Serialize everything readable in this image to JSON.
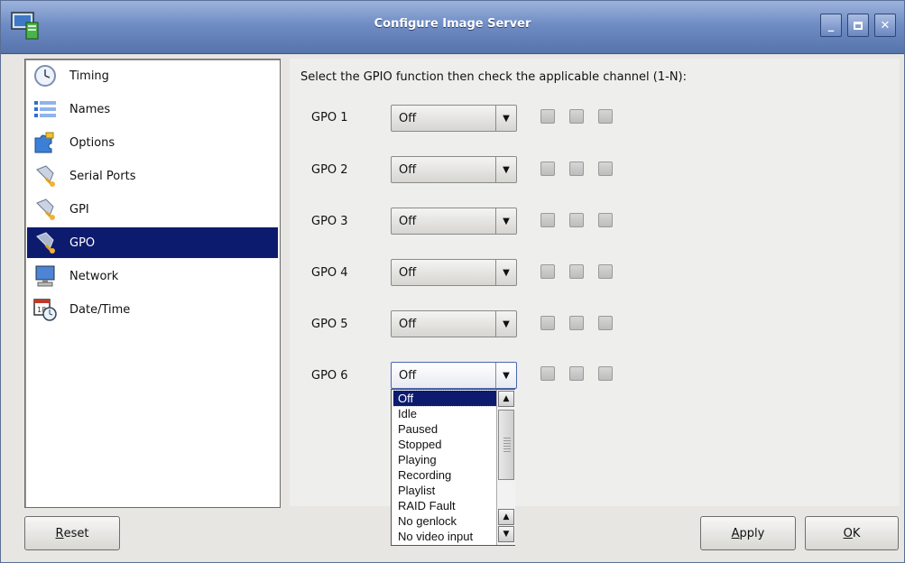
{
  "window": {
    "title": "Configure Image Server",
    "controls": [
      "minimize",
      "maximize",
      "close"
    ]
  },
  "sidebar": {
    "items": [
      {
        "label": "Timing",
        "icon": "clock-icon"
      },
      {
        "label": "Names",
        "icon": "list-icon"
      },
      {
        "label": "Options",
        "icon": "puzzle-icon"
      },
      {
        "label": "Serial Ports",
        "icon": "plug-icon"
      },
      {
        "label": "GPI",
        "icon": "plug-icon"
      },
      {
        "label": "GPO",
        "icon": "plug-icon",
        "selected": true
      },
      {
        "label": "Network",
        "icon": "monitor-icon"
      },
      {
        "label": "Date/Time",
        "icon": "calendar-clock-icon"
      }
    ]
  },
  "main": {
    "instruction": "Select the GPIO function then check the applicable channel (1-N):",
    "gpo_rows": [
      {
        "label": "GPO 1",
        "value": "Off"
      },
      {
        "label": "GPO 2",
        "value": "Off"
      },
      {
        "label": "GPO 3",
        "value": "Off"
      },
      {
        "label": "GPO 4",
        "value": "Off"
      },
      {
        "label": "GPO 5",
        "value": "Off"
      },
      {
        "label": "GPO 6",
        "value": "Off",
        "open": true
      }
    ],
    "dropdown_options": [
      "Off",
      "Idle",
      "Paused",
      "Stopped",
      "Playing",
      "Recording",
      "Playlist",
      "RAID Fault",
      "No genlock",
      "No video input"
    ]
  },
  "buttons": {
    "reset_first": "R",
    "reset_rest": "eset",
    "apply_first": "A",
    "apply_rest": "pply",
    "ok_first": "O",
    "ok_rest": "K"
  },
  "colors": {
    "selection": "#0d1b6e",
    "titlebar": "#6f8cc4"
  }
}
